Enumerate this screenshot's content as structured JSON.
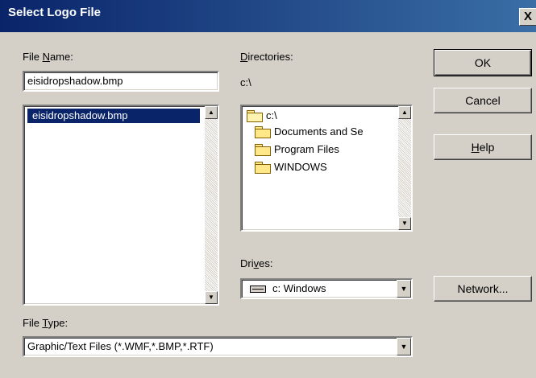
{
  "dialog": {
    "title": "Select Logo File",
    "close_glyph": "X"
  },
  "file_name": {
    "label_pre": "File ",
    "label_key": "N",
    "label_post": "ame:",
    "value": "eisidropshadow.bmp",
    "files": [
      "eisidropshadow.bmp"
    ]
  },
  "directories": {
    "label_pre": "",
    "label_key": "D",
    "label_post": "irectories:",
    "current": "c:\\",
    "tree": [
      {
        "label": "c:\\",
        "icon": "open-folder-icon"
      },
      {
        "label": "Documents and Se",
        "icon": "folder-icon"
      },
      {
        "label": "Program Files",
        "icon": "folder-icon"
      },
      {
        "label": "WINDOWS",
        "icon": "folder-icon"
      }
    ]
  },
  "drives": {
    "label_pre": "Dri",
    "label_key": "v",
    "label_post": "es:",
    "selected": "c: Windows",
    "icon": "drive-icon"
  },
  "file_type": {
    "label_pre": "File ",
    "label_key": "T",
    "label_post": "ype:",
    "selected": "Graphic/Text Files (*.WMF,*.BMP,*.RTF)"
  },
  "buttons": {
    "ok": "OK",
    "cancel": "Cancel",
    "help_key": "H",
    "help_post": "elp",
    "network": "Network..."
  },
  "colors": {
    "titlebar": "#0a246a",
    "selection": "#0a246a",
    "face": "#d4d0c8"
  }
}
